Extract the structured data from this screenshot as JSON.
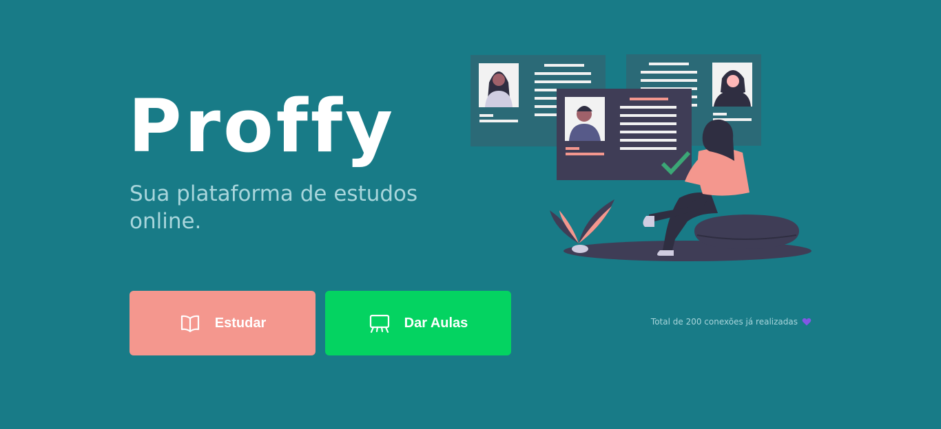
{
  "brand": {
    "name": "Proffy",
    "tagline": "Sua plataforma de estudos online."
  },
  "hero": {
    "icon": "teacher-profiles-illustration"
  },
  "buttons": {
    "study_label": "Estudar",
    "study_icon": "book-open-icon",
    "give_classes_label": "Dar Aulas",
    "give_classes_icon": "presentation-board-icon"
  },
  "connections": {
    "text": "Total de 200 conexões já realizadas",
    "icon": "purple-heart-icon"
  },
  "colors": {
    "background": "#187B87",
    "study_button": "#F4978E",
    "give_classes_button": "#04D361",
    "heart": "#8257E5",
    "tagline": "#A9D6DC"
  }
}
